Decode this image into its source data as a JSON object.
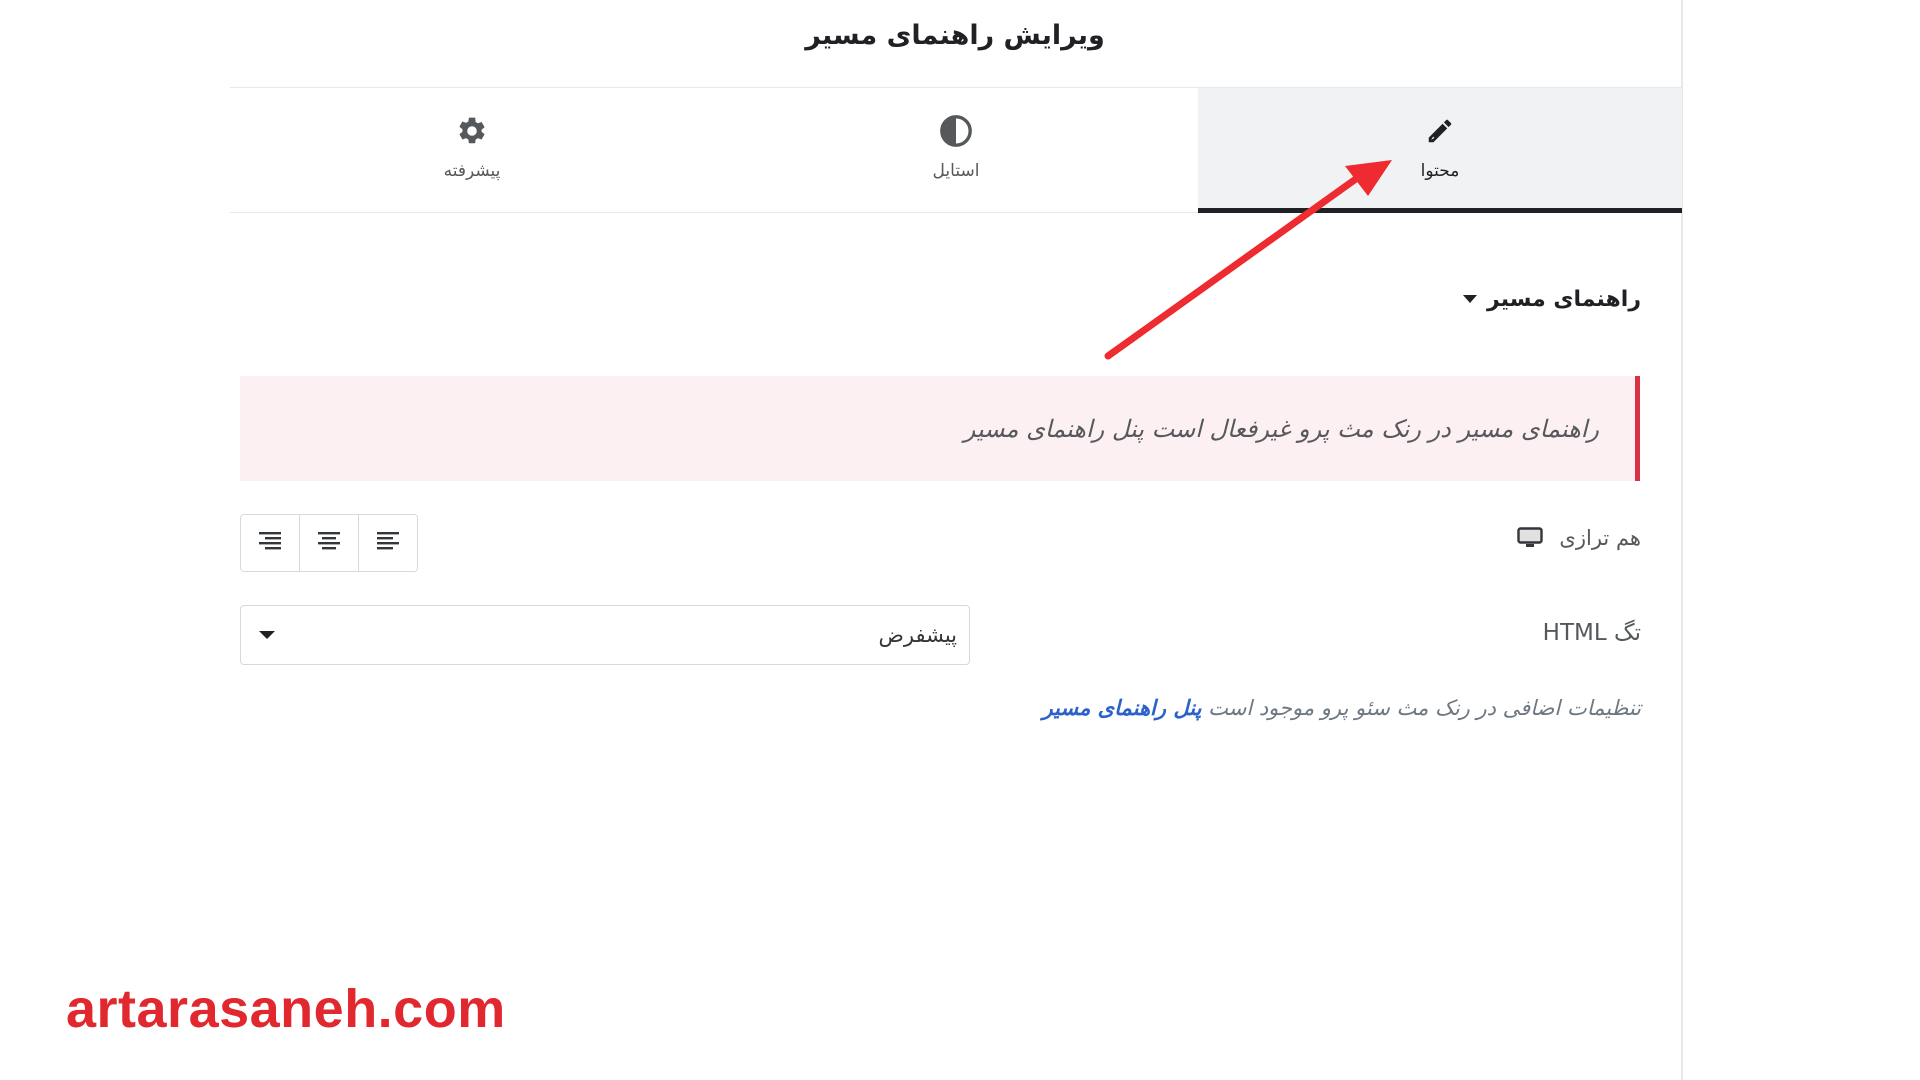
{
  "panel": {
    "title": "ویرایش راهنمای مسیر"
  },
  "tabs": [
    {
      "label": "محتوا",
      "icon": "pencil-icon",
      "active": true
    },
    {
      "label": "استایل",
      "icon": "contrast-icon",
      "active": false
    },
    {
      "label": "پیشرفته",
      "icon": "gear-icon",
      "active": false
    }
  ],
  "section": {
    "title": "راهنمای مسیر"
  },
  "notice": {
    "text": "راهنمای مسیر در رنک مث پرو غیرفعال است پنل راهنمای مسیر"
  },
  "alignment": {
    "label": "هم ترازی",
    "device_icon": "desktop-icon",
    "options": [
      "align-right-icon",
      "align-center-icon",
      "align-left-icon"
    ]
  },
  "html_tag": {
    "label": "تگ HTML",
    "value": "پیشفرض"
  },
  "footer": {
    "text": "تنظیمات اضافی در رنک مث سئو پرو موجود است",
    "link": "پنل راهنمای مسیر"
  },
  "watermark": {
    "text": "artarasaneh.com"
  },
  "colors": {
    "accent_red": "#e0282e",
    "notice_bg": "#fdf0f2",
    "notice_border": "#d93244",
    "link_blue": "#2a62c9",
    "active_tab_bg": "#f1f2f4"
  }
}
